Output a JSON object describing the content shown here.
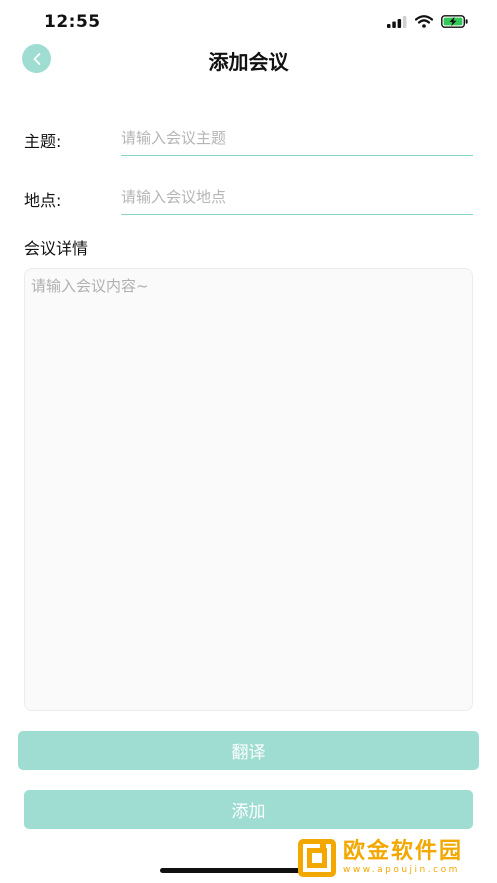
{
  "status_bar": {
    "time": "12:55",
    "icons": [
      "signal-icon",
      "wifi-icon",
      "battery-charging-icon"
    ]
  },
  "nav": {
    "title": "添加会议",
    "back_icon": "chevron-left-icon"
  },
  "form": {
    "subject": {
      "label": "主题:",
      "placeholder": "请输入会议主题"
    },
    "location": {
      "label": "地点:",
      "placeholder": "请输入会议地点"
    },
    "details": {
      "label": "会议详情",
      "placeholder": "请输入会议内容~"
    }
  },
  "actions": {
    "translate_label": "翻译",
    "add_label": "添加"
  },
  "colors": {
    "accent": "#9fddd3",
    "underline": "#86d4c8",
    "watermark": "#f2a800"
  },
  "watermark": {
    "main": "欧金软件园",
    "sub": "www.apoujin.com"
  }
}
